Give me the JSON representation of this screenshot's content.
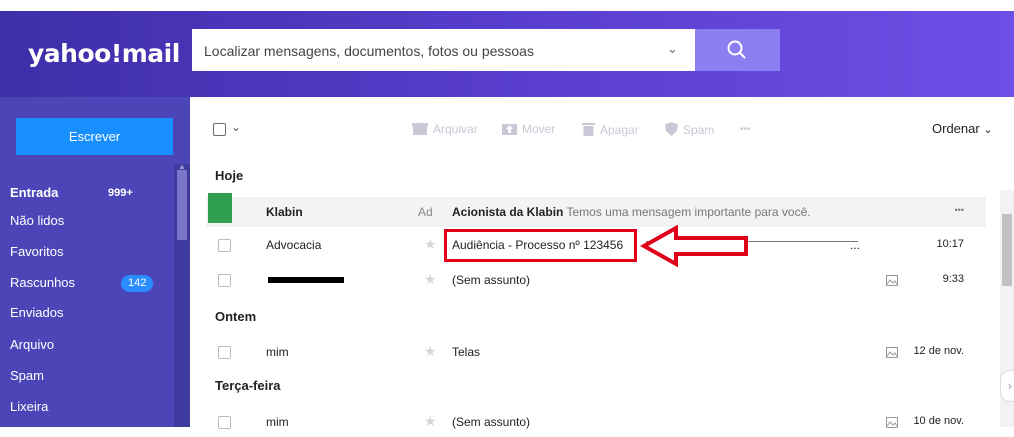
{
  "app": {
    "logo": "yahoo!mail"
  },
  "search": {
    "placeholder": "Localizar mensagens, documentos, fotos ou pessoas"
  },
  "sidebar": {
    "compose_label": "Escrever",
    "folders": [
      {
        "label": "Entrada",
        "count": "999+"
      },
      {
        "label": "Não lidos"
      },
      {
        "label": "Favoritos"
      },
      {
        "label": "Rascunhos",
        "count": "142"
      },
      {
        "label": "Enviados"
      },
      {
        "label": "Arquivo"
      },
      {
        "label": "Spam"
      },
      {
        "label": "Lixeira"
      }
    ]
  },
  "toolbar": {
    "archive": "Arquivar",
    "move": "Mover",
    "delete": "Apagar",
    "spam": "Spam",
    "more": "•••",
    "sort": "Ordenar"
  },
  "sections": {
    "today": "Hoje",
    "yesterday": "Ontem",
    "tuesday": "Terça-feira"
  },
  "messages": [
    {
      "sender": "Klabin",
      "tag": "Ad",
      "subject": "Acionista da Klabin",
      "preview": "Temos uma mensagem importante para você.",
      "time": "•••"
    },
    {
      "sender": "Advocacia",
      "subject": "Audiência - Processo nº 123456",
      "trail": "...",
      "time": "10:17"
    },
    {
      "sender": "",
      "subject": "(Sem assunto)",
      "time": "9:33"
    },
    {
      "sender": "mim",
      "subject": "Telas",
      "time": "12 de nov."
    },
    {
      "sender": "mim",
      "subject": "(Sem assunto)",
      "time": "10 de nov."
    }
  ],
  "colors": {
    "header": "#5b3fd0",
    "sidebar": "#4c45b8",
    "compose": "#188fff",
    "highlight": "#e0001a"
  }
}
